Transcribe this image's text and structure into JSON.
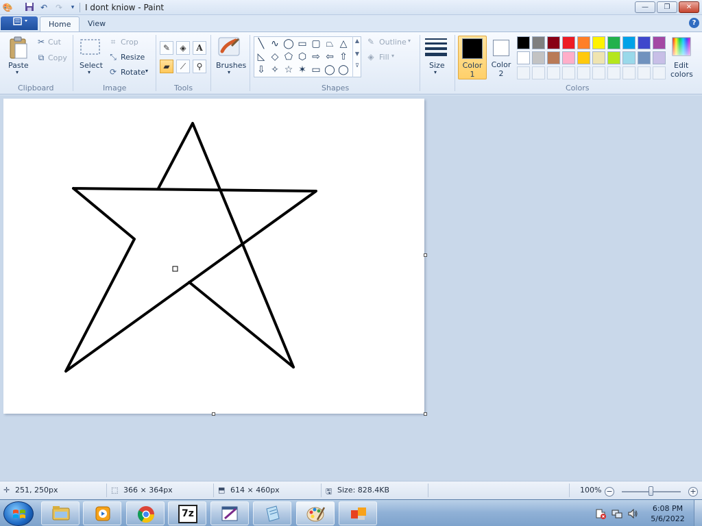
{
  "window": {
    "title": "I dont kniow - Paint",
    "minimize_glyph": "—",
    "maximize_glyph": "❐",
    "close_glyph": "✕"
  },
  "qat": {
    "app_icon": "paint-palette-icon",
    "save_icon": "save-icon",
    "undo_icon": "undo-icon",
    "redo_icon": "redo-icon",
    "customize_icon": "dropdown-arrow-icon"
  },
  "tabs": [
    {
      "label": "Home",
      "active": true
    },
    {
      "label": "View",
      "active": false
    }
  ],
  "help_glyph": "?",
  "ribbon": {
    "clipboard": {
      "label": "Clipboard",
      "paste": "Paste",
      "cut": "Cut",
      "copy": "Copy"
    },
    "image": {
      "label": "Image",
      "select": "Select",
      "crop": "Crop",
      "resize": "Resize",
      "rotate": "Rotate"
    },
    "tools": {
      "label": "Tools",
      "items": [
        "pencil-icon",
        "fill-bucket-icon",
        "text-icon",
        "eraser-icon",
        "color-picker-icon",
        "magnifier-icon"
      ]
    },
    "brushes": {
      "label": "Brushes"
    },
    "shapes": {
      "label": "Shapes",
      "outline": "Outline",
      "fill": "Fill",
      "glyphs": [
        "╲",
        "∿",
        "◯",
        "▭",
        "▢",
        "⏢",
        "△",
        "◺",
        "◇",
        "⬠",
        "⬡",
        "⇨",
        "⇦",
        "⇧",
        "⇩",
        "✧",
        "☆",
        "✶",
        "▭",
        "◯",
        "◯"
      ]
    },
    "size": {
      "label": "Size"
    },
    "colors": {
      "label": "Colors",
      "color1_line1": "Color",
      "color1_line2": "1",
      "color2_line1": "Color",
      "color2_line2": "2",
      "edit_line1": "Edit",
      "edit_line2": "colors",
      "color1_value": "#000000",
      "color2_value": "#ffffff",
      "palette_row1": [
        "#000000",
        "#7f7f7f",
        "#880015",
        "#ed1c24",
        "#ff7f27",
        "#fff200",
        "#22b14c",
        "#00a2e8",
        "#3f48cc",
        "#a349a4"
      ],
      "palette_row2": [
        "#ffffff",
        "#c3c3c3",
        "#b97a57",
        "#ffaec9",
        "#ffc90e",
        "#efe4b0",
        "#b5e61d",
        "#99d9ea",
        "#7092be",
        "#c8bfe7"
      ]
    }
  },
  "drawing": {
    "description_color": "#000000"
  },
  "status": {
    "cursor_pos": "251, 250px",
    "selection_size": "366 × 364px",
    "image_size": "614 × 460px",
    "file_size": "Size: 828.4KB",
    "zoom": "100%",
    "zoom_level": 1.0
  },
  "taskbar": {
    "apps": [
      "file-explorer-icon",
      "media-player-icon",
      "chrome-icon",
      "7zip-icon",
      "paint-brush-app-icon",
      "notepad-icon",
      "paint-icon",
      "office-icon"
    ],
    "seven_zip_label": "7z",
    "time": "6:08 PM",
    "date": "5/6/2022"
  }
}
